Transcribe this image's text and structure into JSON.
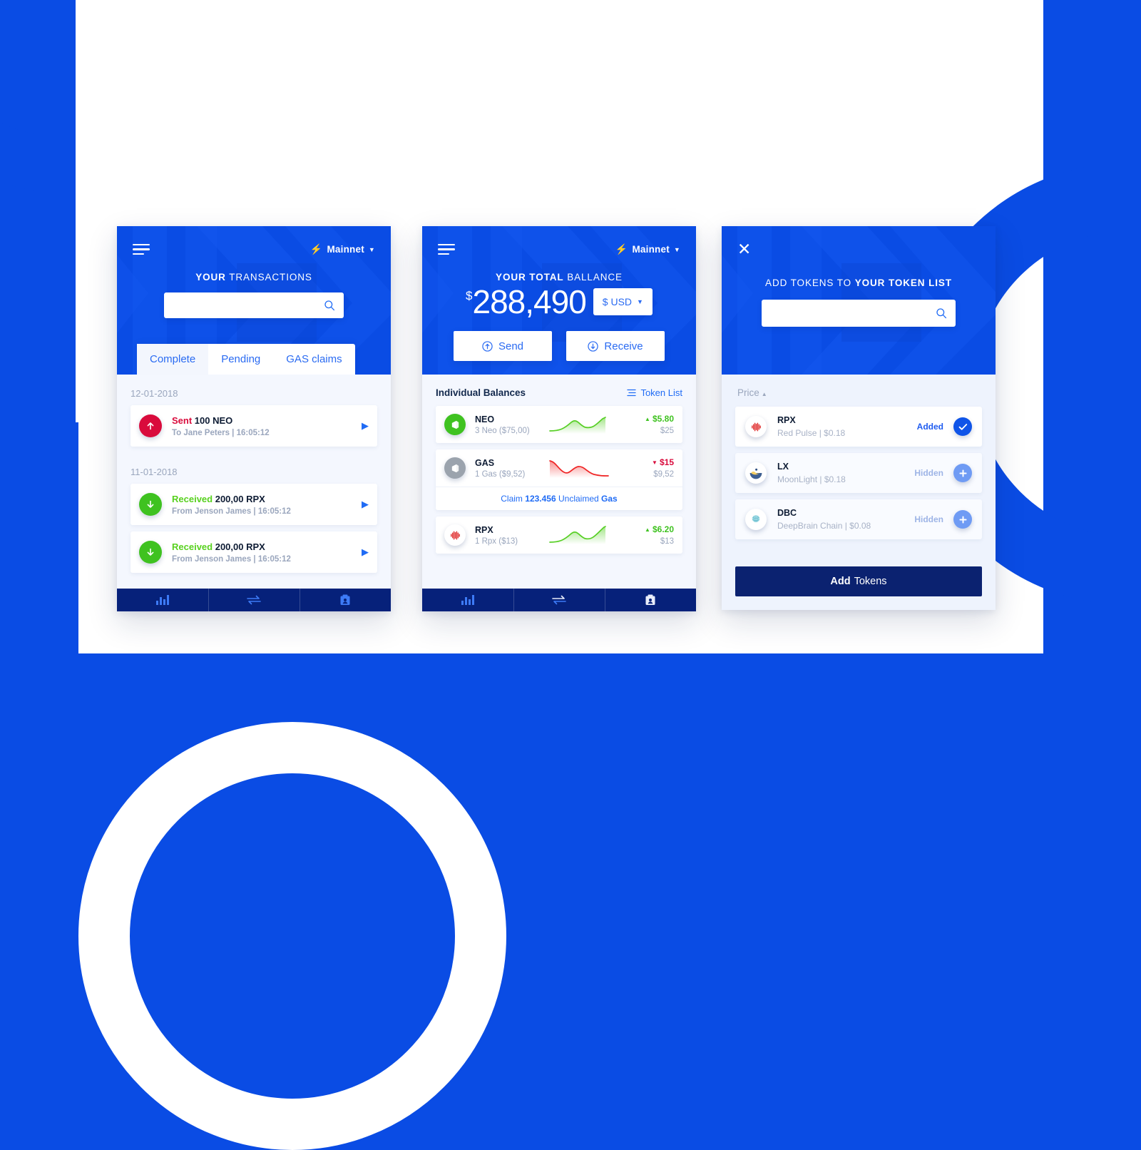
{
  "theme": {
    "blue": "#0a4ce4",
    "accent": "#1f6bf5",
    "navy": "#06217a",
    "green": "#3fc220",
    "red": "#d90b3c",
    "panel_bg": "#f4f7fe",
    "muted": "#9aa6bd"
  },
  "transactions_panel": {
    "menu_icon": "hamburger-icon",
    "network": {
      "label": "Mainnet",
      "bolt_icon": "bolt-icon",
      "caret_icon": "chevron-down-icon"
    },
    "title_bold": "YOUR",
    "title_rest": "TRANSACTIONS",
    "search": {
      "value": "",
      "placeholder": "",
      "icon": "search-icon"
    },
    "tabs": [
      {
        "label": "Complete",
        "active": true
      },
      {
        "label": "Pending",
        "active": false
      },
      {
        "label": "GAS claims",
        "active": false
      }
    ],
    "groups": [
      {
        "date": "12-01-2018",
        "items": [
          {
            "direction": "Sent",
            "direction_type": "sent",
            "amount": "100 NEO",
            "counterparty": "To Jane Peters",
            "time": "16:05:12",
            "icon": "arrow-up-icon",
            "chevron": "play-arrow-icon"
          }
        ]
      },
      {
        "date": "11-01-2018",
        "items": [
          {
            "direction": "Received",
            "direction_type": "received",
            "amount": "200,00 RPX",
            "counterparty": "From Jenson James",
            "time": "16:05:12",
            "icon": "arrow-down-icon",
            "chevron": "play-arrow-icon"
          },
          {
            "direction": "Received",
            "direction_type": "received",
            "amount": "200,00 RPX",
            "counterparty": "From Jenson James",
            "time": "16:05:12",
            "icon": "arrow-down-icon",
            "chevron": "play-arrow-icon"
          }
        ]
      }
    ],
    "bottom_nav": [
      {
        "icon": "bar-chart-icon",
        "active": true
      },
      {
        "icon": "transfer-arrows-icon",
        "active": false
      },
      {
        "icon": "address-book-icon",
        "active": false
      }
    ]
  },
  "balance_panel": {
    "menu_icon": "hamburger-icon",
    "network": {
      "label": "Mainnet",
      "bolt_icon": "bolt-icon",
      "caret_icon": "chevron-down-icon"
    },
    "title_bold": "YOUR TOTAL",
    "title_rest": "BALLANCE",
    "currency_symbol": "$",
    "total": "288,490",
    "currency_selector": {
      "label": "$ USD",
      "caret_icon": "chevron-down-icon"
    },
    "actions": [
      {
        "label": "Send",
        "icon": "arrow-up-circle-icon"
      },
      {
        "label": "Receive",
        "icon": "arrow-down-circle-icon"
      }
    ],
    "section_title": "Individual Balances",
    "token_list_link": {
      "label": "Token List",
      "icon": "list-icon"
    },
    "tokens": [
      {
        "symbol": "NEO",
        "icon": "neo-coin-icon",
        "holdings": "3 Neo ($75,00)",
        "delta": "$5.80",
        "delta_dir": "up",
        "fiat": "$25",
        "trend": "up"
      },
      {
        "symbol": "GAS",
        "icon": "gas-coin-icon",
        "holdings": "1 Gas ($9,52)",
        "delta": "$15",
        "delta_dir": "down",
        "fiat": "$9,52",
        "trend": "down",
        "claim": {
          "pre": "Claim",
          "amount": "123.456",
          "mid": "Unclaimed",
          "post": "Gas"
        }
      },
      {
        "symbol": "RPX",
        "icon": "rpx-coin-icon",
        "holdings": "1 Rpx ($13)",
        "delta": "$6.20",
        "delta_dir": "up",
        "fiat": "$13",
        "trend": "up"
      }
    ],
    "bottom_nav": [
      {
        "icon": "bar-chart-icon",
        "active": true
      },
      {
        "icon": "transfer-arrows-icon",
        "active": false
      },
      {
        "icon": "address-book-icon",
        "active": false
      }
    ]
  },
  "add_tokens_panel": {
    "close_icon": "close-icon",
    "title_rest": "ADD TOKENS TO ",
    "title_bold": "YOUR TOKEN LIST",
    "search": {
      "value": "",
      "placeholder": "",
      "icon": "search-icon"
    },
    "sort": {
      "label": "Price",
      "icon": "caret-up-icon"
    },
    "tokens": [
      {
        "symbol": "RPX",
        "icon": "rpx-coin-icon",
        "desc": "Red Pulse | $0.18",
        "state": "Added",
        "state_type": "added",
        "button_icon": "check-icon"
      },
      {
        "symbol": "LX",
        "icon": "moonlight-coin-icon",
        "desc": "MoonLight | $0.18",
        "state": "Hidden",
        "state_type": "hidden",
        "button_icon": "plus-icon"
      },
      {
        "symbol": "DBC",
        "icon": "deepbrain-coin-icon",
        "desc": "DeepBrain Chain | $0.08",
        "state": "Hidden",
        "state_type": "hidden",
        "button_icon": "plus-icon"
      }
    ],
    "cta": {
      "bold": "Add",
      "thin": "Tokens"
    }
  }
}
